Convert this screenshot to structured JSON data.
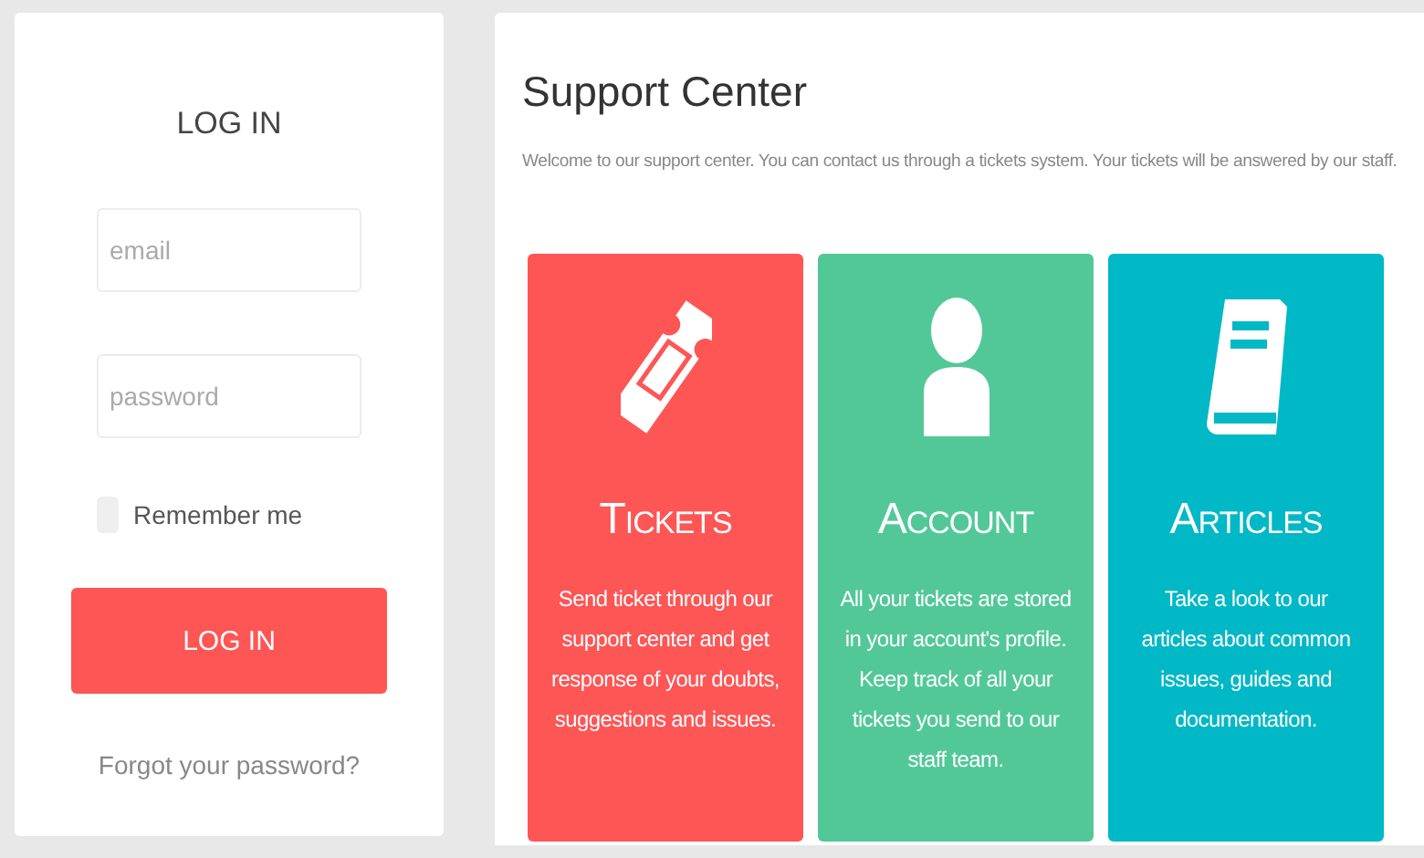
{
  "login": {
    "title": "LOG IN",
    "email": {
      "placeholder": "email"
    },
    "password": {
      "placeholder": "password"
    },
    "remember": {
      "label": "Remember me",
      "checked": false
    },
    "button": "LOG IN",
    "forgot": "Forgot your password?"
  },
  "support": {
    "title": "Support Center",
    "intro": "Welcome to our support center. You can contact us through a tickets system. Your tickets will be answered by our staff.",
    "cards": [
      {
        "kind": "ticket",
        "color": "#fe5555",
        "title": "Tickets",
        "text": "Send ticket through our support center and get response of your doubts, suggestions and issues."
      },
      {
        "kind": "user",
        "color": "#52c899",
        "title": "Account",
        "text": "All your tickets are stored in your account's profile. Keep track of all your tickets you send to our staff team."
      },
      {
        "kind": "book",
        "color": "#00b8c6",
        "title": "Articles",
        "text": "Take a look to our articles about common issues, guides and documentation."
      }
    ]
  }
}
